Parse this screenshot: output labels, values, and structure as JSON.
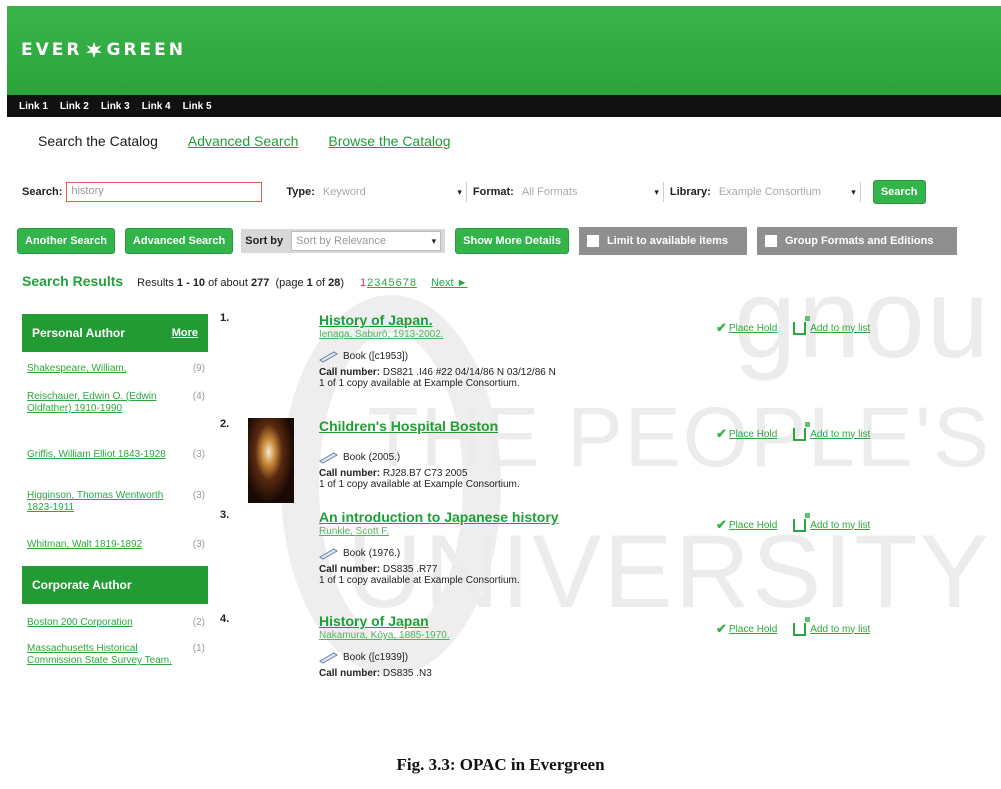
{
  "logo": {
    "text_left": "EVER",
    "text_right": "GREEN"
  },
  "topnav": [
    "Link 1",
    "Link 2",
    "Link 3",
    "Link 4",
    "Link 5"
  ],
  "tabs": {
    "search": "Search the Catalog",
    "advanced": "Advanced Search",
    "browse": "Browse the Catalog"
  },
  "search": {
    "label": "Search:",
    "value": "history",
    "type_label": "Type:",
    "type_value": "Keyword",
    "format_label": "Format:",
    "format_value": "All Formats",
    "library_label": "Library:",
    "library_value": "Example Consortium",
    "button": "Search"
  },
  "controls": {
    "another_search": "Another Search",
    "advanced_search": "Advanced Search",
    "sort_label": "Sort by",
    "sort_value": "Sort by Relevance",
    "show_more": "Show More Details",
    "limit_available": "Limit to available items",
    "group_formats": "Group Formats and Editions"
  },
  "results_header": {
    "title": "Search Results",
    "results_prefix": "Results",
    "range": "1 - 10",
    "of_about": "of about",
    "total": "277",
    "page_text_a": "(page",
    "page_current": "1",
    "page_text_b": "of",
    "page_total": "28",
    "page_text_c": ")",
    "pages_current": "1",
    "pages_rest": "2345678",
    "next": "Next ►"
  },
  "facets": {
    "personal_author": {
      "title": "Personal Author",
      "more": "More",
      "items": [
        {
          "name": "Shakespeare, William,",
          "count": "(9)"
        },
        {
          "name": "Reischauer, Edwin O. (Edwin Oldfather) 1910-1990",
          "count": "(4)"
        },
        {
          "name": "Griffis, William Elliot 1843-1928",
          "count": "(3)"
        },
        {
          "name": "Higginson, Thomas Wentworth 1823-1911",
          "count": "(3)"
        },
        {
          "name": "Whitman, Walt 1819-1892",
          "count": "(3)"
        }
      ]
    },
    "corporate_author": {
      "title": "Corporate Author",
      "items": [
        {
          "name": "Boston 200 Corporation",
          "count": "(2)"
        },
        {
          "name": "Massachusetts Historical Commission State Survey Team.",
          "count": "(1)"
        }
      ]
    }
  },
  "results": [
    {
      "num": "1.",
      "title": "History of Japan.",
      "author": "Ienaga, Saburō, 1913-2002.",
      "format": "Book ([c1953])",
      "call_label": "Call number:",
      "call": "DS821 .I46 #22 04/14/86 N 03/12/86 N",
      "copy": "1 of 1 copy available at Example Consortium."
    },
    {
      "num": "2.",
      "title": "Children's Hospital Boston",
      "author": "",
      "format": "Book (2005.)",
      "call_label": "Call number:",
      "call": "RJ28.B7 C73 2005",
      "copy": "1 of 1 copy available at Example Consortium."
    },
    {
      "num": "3.",
      "title": "An introduction to Japanese history",
      "author": "Runkle, Scott F.",
      "format": "Book (1976.)",
      "call_label": "Call number:",
      "call": "DS835 .R77",
      "copy": "1 of 1 copy available at Example Consortium."
    },
    {
      "num": "4.",
      "title": "History of Japan",
      "author": "Nakamura, Kōya, 1885-1970.",
      "format": "Book ([c1939])",
      "call_label": "Call number:",
      "call": "DS835 .N3",
      "copy": ""
    }
  ],
  "actions": {
    "place_hold": "Place Hold",
    "add_list": "Add to my list"
  },
  "watermark": {
    "line1": "gnou",
    "line2": "THE PEOPLE'S",
    "line3": "UNIVERSITY"
  },
  "caption": "Fig. 3.3: OPAC in Evergreen"
}
